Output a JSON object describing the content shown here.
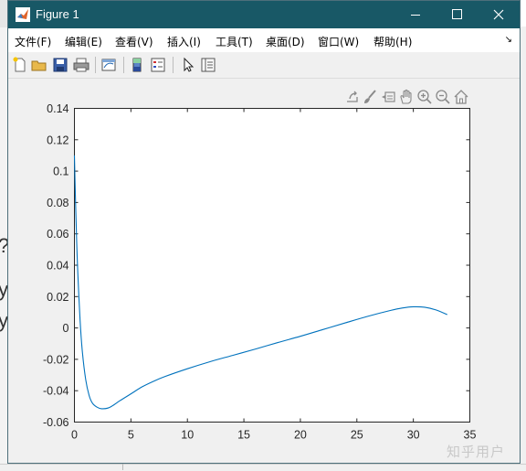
{
  "window": {
    "title": "Figure 1"
  },
  "menubar": {
    "items": [
      "文件(F)",
      "编辑(E)",
      "查看(V)",
      "插入(I)",
      "工具(T)",
      "桌面(D)",
      "窗口(W)",
      "帮助(H)"
    ]
  },
  "toolbar": {
    "buttons": [
      "new-figure-icon",
      "open-file-icon",
      "save-icon",
      "print-icon",
      "link-plot-icon",
      "insert-colorbar-icon",
      "insert-legend-icon",
      "edit-plot-icon",
      "property-inspector-icon"
    ]
  },
  "axes_toolbar": {
    "buttons": [
      "export-icon",
      "brush-icon",
      "data-tips-icon",
      "pan-icon",
      "zoom-in-icon",
      "zoom-out-icon",
      "home-icon"
    ]
  },
  "background": {
    "left_glyphs": [
      "?",
      "y",
      "y"
    ]
  },
  "watermark": "知乎用户",
  "colors": {
    "titlebar": "#185866",
    "line": "#0072bd",
    "window_bg": "#f0f0f0"
  },
  "chart_data": {
    "type": "line",
    "title": "",
    "xlabel": "",
    "ylabel": "",
    "xlim": [
      0,
      35
    ],
    "ylim": [
      -0.06,
      0.14
    ],
    "xticks": [
      0,
      5,
      10,
      15,
      20,
      25,
      30,
      35
    ],
    "yticks": [
      -0.06,
      -0.04,
      -0.02,
      0,
      0.02,
      0.04,
      0.06,
      0.08,
      0.1,
      0.12,
      0.14
    ],
    "ytick_labels": [
      "-0.06",
      "-0.04",
      "-0.02",
      "0",
      "0.02",
      "0.04",
      "0.06",
      "0.08",
      "0.1",
      "0.12",
      "0.14"
    ],
    "xtick_labels": [
      "0",
      "5",
      "10",
      "15",
      "20",
      "25",
      "30",
      "35"
    ],
    "grid": false,
    "series": [
      {
        "color": "#0072bd",
        "x": [
          0,
          0.1,
          0.2,
          0.3,
          0.5,
          0.7,
          1.0,
          1.3,
          1.6,
          2.0,
          2.4,
          3.0,
          3.5,
          4.0,
          5.0,
          6.0,
          7.0,
          8.0,
          10.0,
          12.0,
          14.0,
          16.0,
          18.0,
          20.0,
          22.0,
          24.0,
          26.0,
          28.0,
          29.0,
          30.0,
          31.0,
          32.0,
          33.0
        ],
        "y": [
          0.11,
          0.08,
          0.055,
          0.035,
          0.005,
          -0.015,
          -0.033,
          -0.043,
          -0.048,
          -0.0505,
          -0.0515,
          -0.051,
          -0.049,
          -0.0465,
          -0.042,
          -0.0375,
          -0.034,
          -0.031,
          -0.026,
          -0.0215,
          -0.0175,
          -0.0135,
          -0.0093,
          -0.0053,
          -0.001,
          0.0033,
          0.0075,
          0.0112,
          0.0127,
          0.0135,
          0.0132,
          0.0115,
          0.0085
        ]
      }
    ]
  }
}
